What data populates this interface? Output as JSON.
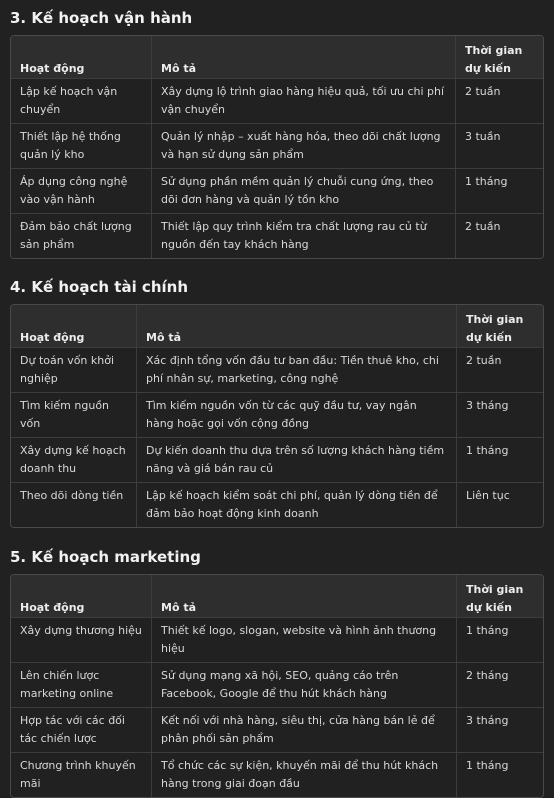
{
  "sections": [
    {
      "title": "3. Kế hoạch vận hành",
      "headers": [
        "Hoạt động",
        "Mô tả",
        "Thời gian dự kiến"
      ],
      "rows": [
        [
          "Lập kế hoạch vận chuyển",
          "Xây dựng lộ trình giao hàng hiệu quả, tối ưu chi phí vận chuyển",
          "2 tuần"
        ],
        [
          "Thiết lập hệ thống quản lý kho",
          "Quản lý nhập – xuất hàng hóa, theo dõi chất lượng và hạn sử dụng sản phẩm",
          "3 tuần"
        ],
        [
          "Áp dụng công nghệ vào vận hành",
          "Sử dụng phần mềm quản lý chuỗi cung ứng, theo dõi đơn hàng và quản lý tồn kho",
          "1 tháng"
        ],
        [
          "Đảm bảo chất lượng sản phẩm",
          "Thiết lập quy trình kiểm tra chất lượng rau củ từ nguồn đến tay khách hàng",
          "2 tuần"
        ]
      ]
    },
    {
      "title": "4. Kế hoạch tài chính",
      "headers": [
        "Hoạt động",
        "Mô tả",
        "Thời gian dự kiến"
      ],
      "rows": [
        [
          "Dự toán vốn khởi nghiệp",
          "Xác định tổng vốn đầu tư ban đầu: Tiền thuê kho, chi phí nhân sự, marketing, công nghệ",
          "2 tuần"
        ],
        [
          "Tìm kiếm nguồn vốn",
          "Tìm kiếm nguồn vốn từ các quỹ đầu tư, vay ngân hàng hoặc gọi vốn cộng đồng",
          "3 tháng"
        ],
        [
          "Xây dựng kế hoạch doanh thu",
          "Dự kiến doanh thu dựa trên số lượng khách hàng tiềm năng và giá bán rau củ",
          "1 tháng"
        ],
        [
          "Theo dõi dòng tiền",
          "Lập kế hoạch kiểm soát chi phí, quản lý dòng tiền để đảm bảo hoạt động kinh doanh",
          "Liên tục"
        ]
      ]
    },
    {
      "title": "5. Kế hoạch marketing",
      "headers": [
        "Hoạt động",
        "Mô tả",
        "Thời gian dự kiến"
      ],
      "rows": [
        [
          "Xây dựng thương hiệu",
          "Thiết kế logo, slogan, website và hình ảnh thương hiệu",
          "1 tháng"
        ],
        [
          "Lên chiến lược marketing online",
          "Sử dụng mạng xã hội, SEO, quảng cáo trên Facebook, Google để thu hút khách hàng",
          "2 tháng"
        ],
        [
          "Hợp tác với các đối tác chiến lược",
          "Kết nối với nhà hàng, siêu thị, cửa hàng bán lẻ để phân phối sản phẩm",
          "3 tháng"
        ],
        [
          "Chương trình khuyến mãi",
          "Tổ chức các sự kiện, khuyến mãi để thu hút khách hàng trong giai đoạn đầu",
          "1 tháng"
        ]
      ]
    }
  ]
}
